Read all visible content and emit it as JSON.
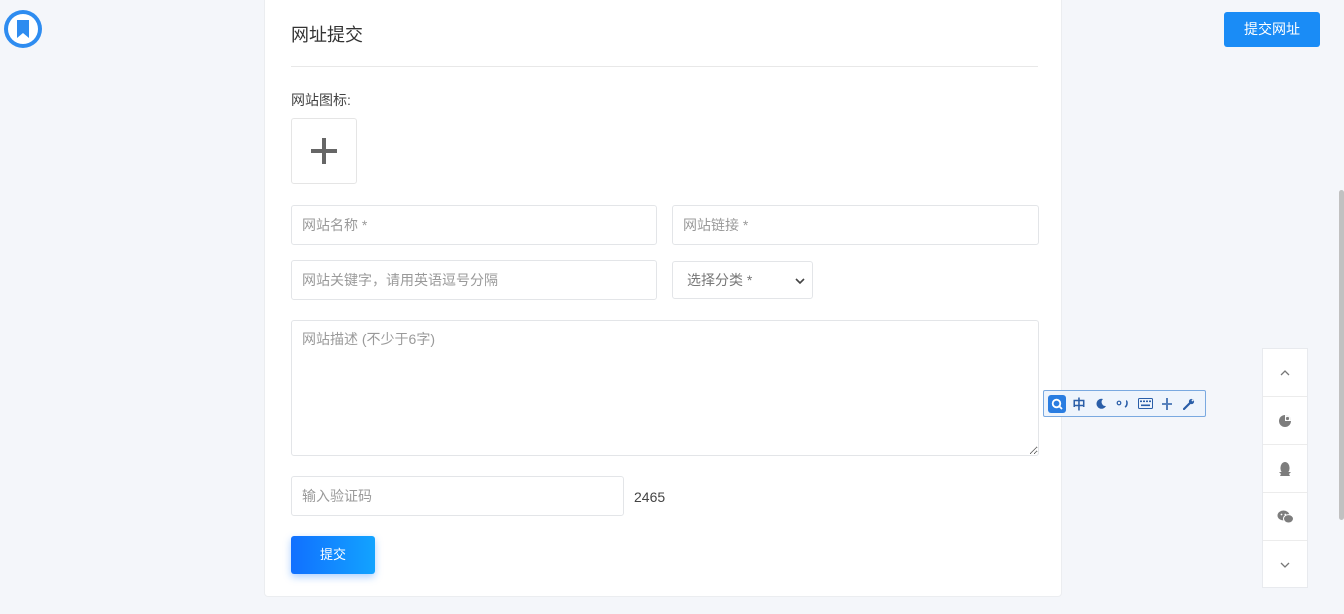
{
  "header": {
    "submit_site_button": "提交网址"
  },
  "form": {
    "title": "网址提交",
    "site_icon_label": "网站图标:",
    "site_name_placeholder": "网站名称 *",
    "site_url_placeholder": "网站链接 *",
    "keywords_placeholder": "网站关键字，请用英语逗号分隔",
    "category_selected": "选择分类 *",
    "description_placeholder": "网站描述 (不少于6字)",
    "captcha_placeholder": "输入验证码",
    "captcha_code": "2465",
    "submit_label": "提交"
  },
  "ime_toolbar": {
    "mode_label": "中"
  },
  "side_tools": [
    {
      "icon": "chevron-up-icon"
    },
    {
      "icon": "theme-toggle-icon"
    },
    {
      "icon": "qq-icon"
    },
    {
      "icon": "wechat-icon"
    },
    {
      "icon": "chevron-down-icon"
    }
  ],
  "colors": {
    "primary": "#1a8cf6",
    "background": "#f4f6fa"
  }
}
